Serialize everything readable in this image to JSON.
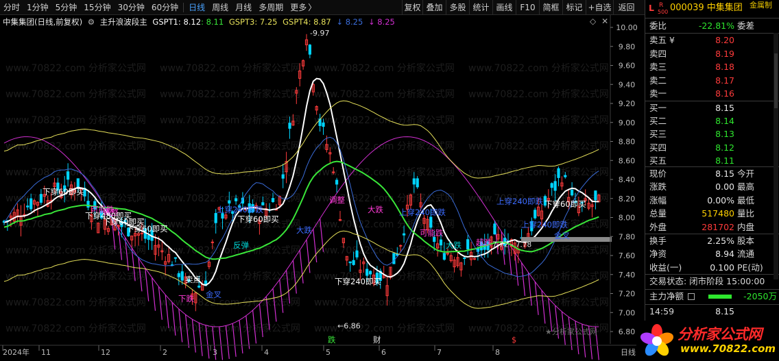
{
  "toolbar": {
    "periods": [
      "分时",
      "1分钟",
      "5分钟",
      "15分钟",
      "30分钟",
      "60分钟",
      "日线",
      "周线",
      "月线",
      "多周期",
      "更多"
    ],
    "active_period": "日线",
    "more_arrow": "〉",
    "right_buttons": [
      "复权",
      "叠加",
      "多股",
      "统计",
      "画线",
      "F10",
      "简框",
      "标记",
      "+自选",
      "返回"
    ]
  },
  "legend": {
    "stock_label": "中集集团(日线,前复权)",
    "indicator_name": "主升浪波段主",
    "gspt1_label": "GSPT1: 8.12",
    "gspt1_arrow": "↑",
    "gspt1_extra": ": 8.11",
    "gspt3_label": "GSPT3: 7.25",
    "gspt4_label": "GSPT4: 8.87",
    "v5": "↓ 8.25",
    "v6": "↓ 8.25"
  },
  "chart": {
    "price_axis": [
      "10.00",
      "9.80",
      "9.60",
      "9.40",
      "9.20",
      "9.00",
      "8.80",
      "8.60",
      "8.40",
      "8.20",
      "8.00",
      "7.80",
      "7.60",
      "7.40",
      "7.20",
      "7.00",
      "6.80"
    ],
    "date_axis": [
      "2024年",
      "11",
      "12",
      "2",
      "3",
      "4",
      "5",
      "6",
      "7",
      "8"
    ],
    "date_axis_end": "日线",
    "high_marker": "9.97",
    "low_marker": "6.86",
    "range_marker": "7.72 - 7.78",
    "watermark_text": "www.70822.com 分析家公式网",
    "footer_mark": "分析家公式网",
    "signals": [
      {
        "text": "下穿60即买",
        "color": "#ffffff"
      },
      {
        "text": "可能跌",
        "color": "#ff3bd6"
      },
      {
        "text": "调整",
        "color": "#ff3bd6"
      },
      {
        "text": "下穿480即买",
        "color": "#ffffff"
      },
      {
        "text": "下穿60即买",
        "color": "#ffffff"
      },
      {
        "text": "下穿60即买",
        "color": "#ffffff"
      },
      {
        "text": "上穿240即跌",
        "color": "#3c6bff"
      },
      {
        "text": "下穿60即买",
        "color": "#ffffff"
      },
      {
        "text": "反弹",
        "color": "#00d4d4"
      },
      {
        "text": "卖点",
        "color": "#ffffff"
      },
      {
        "text": "下跌",
        "color": "#ff3bd6"
      },
      {
        "text": "金叉",
        "color": "#3c6bff"
      },
      {
        "text": "调整",
        "color": "#ff3bd6"
      },
      {
        "text": "大跌",
        "color": "#ff3bd6"
      },
      {
        "text": "大跌",
        "color": "#3c6bff"
      },
      {
        "text": "上穿240即跌",
        "color": "#3c6bff"
      },
      {
        "text": "可能跌",
        "color": "#ff3bd6"
      },
      {
        "text": "下穿240即买",
        "color": "#ffffff"
      },
      {
        "text": "大跌",
        "color": "#00d4d4"
      },
      {
        "text": "超跌",
        "color": "#ff3bd6"
      },
      {
        "text": "上穿240即跌",
        "color": "#3c6bff"
      },
      {
        "text": "下穿60即买",
        "color": "#ffffff"
      },
      {
        "text": "上穿240即跌",
        "color": "#3c6bff"
      },
      {
        "text": "金叉",
        "color": "#3c6bff"
      }
    ],
    "bottom_signals": [
      "跌",
      "财"
    ],
    "bottom_s": "$"
  },
  "panel": {
    "tag_l": "L",
    "tag_r": "R",
    "tag_num": "500",
    "code_name": "000039 中集集团",
    "industry": "金属制",
    "weibi_label": "委比",
    "weibi_value": "-22.81%",
    "weicha_label": "委差",
    "asks": [
      {
        "label": "卖五 ¥",
        "price": "8.20"
      },
      {
        "label": "卖四",
        "price": "8.19"
      },
      {
        "label": "卖三",
        "price": "8.18"
      },
      {
        "label": "卖二",
        "price": "8.17"
      },
      {
        "label": "卖一",
        "price": "8.16"
      }
    ],
    "bids": [
      {
        "label": "买一",
        "price": "8.15"
      },
      {
        "label": "买二",
        "price": "8.14"
      },
      {
        "label": "买三",
        "price": "8.13"
      },
      {
        "label": "买四",
        "price": "8.12"
      },
      {
        "label": "买五",
        "price": "8.11"
      }
    ],
    "stats": [
      {
        "l1": "现价",
        "v1": "8.15",
        "l2": "今开"
      },
      {
        "l1": "涨跌",
        "v1": "0.00",
        "l2": "最高"
      },
      {
        "l1": "涨幅",
        "v1": "0.00%",
        "l2": "最低"
      },
      {
        "l1": "总量",
        "v1": "517480",
        "l2": "量比"
      },
      {
        "l1": "外盘",
        "v1": "281702",
        "l2": "内盘"
      }
    ],
    "stats2": [
      {
        "l1": "换手",
        "v1": "2.25%",
        "l2": "股本"
      },
      {
        "l1": "净资",
        "v1": "8.94",
        "l2": "流通"
      },
      {
        "l1": "收益(一)",
        "v1": "0.100",
        "l2": "PE(动)"
      }
    ],
    "trade_status": "交易状态: 闭市阶段 15:00:00",
    "net_inflow_label": "主力净额",
    "net_inflow_value": "-2050万",
    "ticks": [
      {
        "time": "14:59",
        "price": "8.15"
      },
      {
        "time": "14:59",
        "price": "8.15"
      }
    ]
  },
  "logo": {
    "brand": "分析家公式网",
    "url": "www.70822.com"
  },
  "colors": {
    "up": "#ff3b3b",
    "down": "#00d4ff",
    "ma_white": "#ffffff",
    "ma_green": "#39e639",
    "band_yellow": "#e6e05a",
    "magenta": "#d22fd2",
    "blue_line": "#3a6cd9"
  }
}
